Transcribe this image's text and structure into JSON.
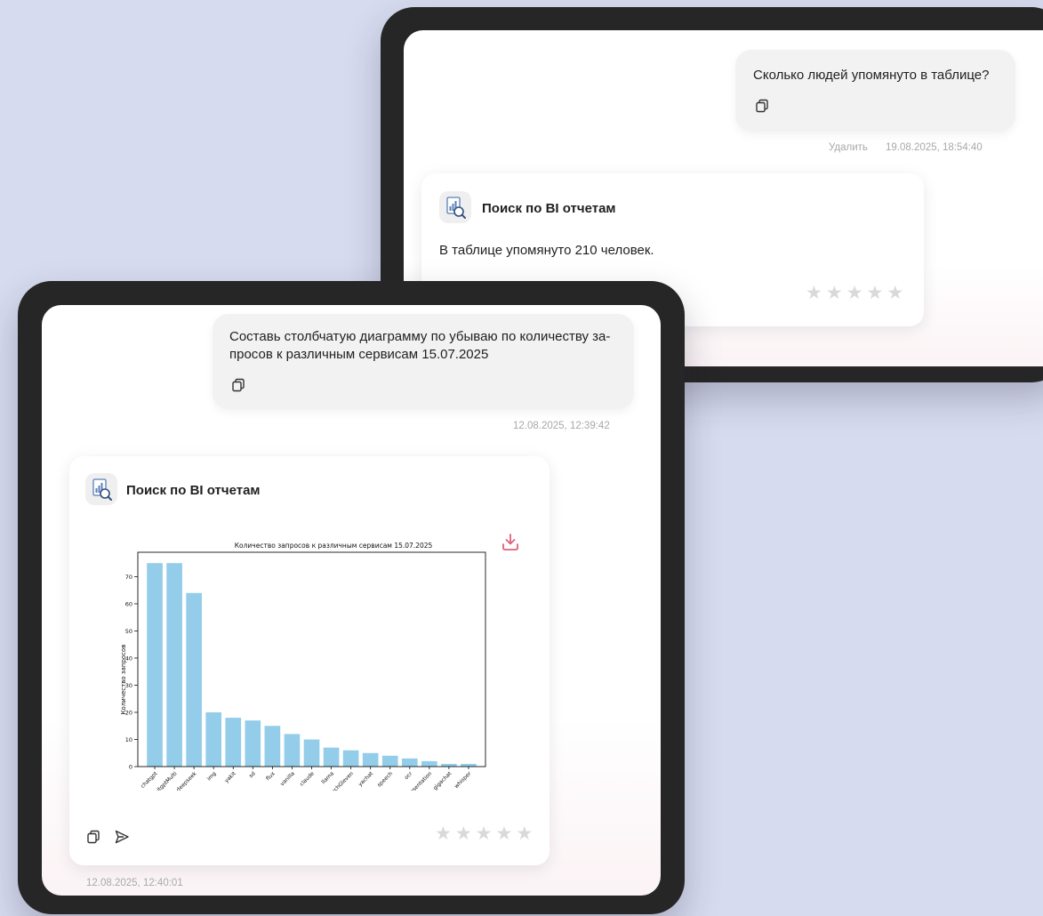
{
  "back_chat": {
    "user_message": {
      "text": "Сколько людей упомянуто в таблице?",
      "delete_label": "Удалить",
      "timestamp": "19.08.2025, 18:54:40"
    },
    "bot_message": {
      "name": "Поиск по BI отчетам",
      "text": "В таблице упомянуто 210 человек.",
      "rating_max": 5
    }
  },
  "front_chat": {
    "user_message": {
      "text_line1": "Составь столбчатую диаграмму по убываю по количеству за-",
      "text_line2": "просов к различным сервисам 15.07.2025",
      "timestamp": "12.08.2025, 12:39:42"
    },
    "bot_message": {
      "name": "Поиск по BI отчетам",
      "timestamp": "12.08.2025, 12:40:01",
      "rating_max": 5
    }
  },
  "icons": {
    "copy": "copy-icon",
    "send": "send-icon",
    "download": "download-icon",
    "star": "star-icon",
    "bot_avatar": "bi-report-search-icon"
  },
  "colors": {
    "background": "#d7dbef",
    "device_frame": "#262626",
    "bar": "#93cde9",
    "download_icon": "#e0607e",
    "star_inactive": "#d9d9d9"
  },
  "chart_data": {
    "type": "bar",
    "title": "Количество запросов к различным сервисам 15.07.2025",
    "xlabel": "",
    "ylabel": "Количество запросов",
    "categories": [
      "chatgpt",
      "bitgptMulti",
      "deepseek",
      "img",
      "yakit",
      "sd",
      "flux",
      "vanilla",
      "claude",
      "llama",
      "techGleven",
      "yachat",
      "speech",
      "ocr",
      "presentation",
      "gigachat",
      "whisper"
    ],
    "values": [
      75,
      75,
      64,
      20,
      18,
      17,
      15,
      12,
      10,
      7,
      6,
      5,
      4,
      3,
      2,
      1,
      1
    ],
    "ylim": [
      0,
      79
    ],
    "yticks": [
      0,
      10,
      20,
      30,
      40,
      50,
      60,
      70
    ],
    "grid": false,
    "legend": "none"
  }
}
